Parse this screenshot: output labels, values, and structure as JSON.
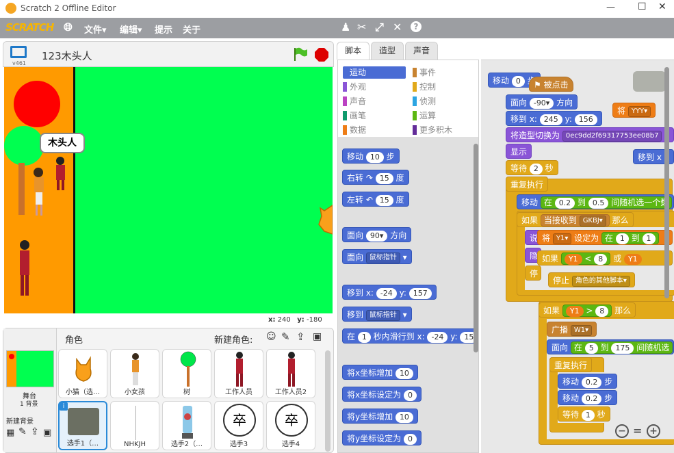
{
  "window": {
    "title": "Scratch 2 Offline Editor",
    "min": "—",
    "max": "☐",
    "close": "✕"
  },
  "menu": {
    "logo": "SCRATCH",
    "file": "文件▾",
    "edit": "编辑▾",
    "tips": "提示",
    "about": "关于"
  },
  "stage": {
    "version": "v461",
    "project_name": "123木头人",
    "speech": "木头人",
    "coord_x_label": "x:",
    "coord_x": "240",
    "coord_y_label": "y:",
    "coord_y": "-180"
  },
  "sprites": {
    "header": "角色",
    "new_sprite": "新建角色:",
    "stage_label": "舞台",
    "stage_sub": "1 背景",
    "new_backdrop": "新建背景",
    "items": [
      "小猫（选…",
      "小女孩",
      "树",
      "工作人员",
      "工作人员2",
      "选手1（…",
      "NHKJH",
      "选手2（…",
      "选手3",
      "选手4"
    ]
  },
  "tabs": [
    "脚本",
    "造型",
    "声音"
  ],
  "categories": {
    "left": [
      "运动",
      "外观",
      "声音",
      "画笔",
      "数据"
    ],
    "right": [
      "事件",
      "控制",
      "侦测",
      "运算",
      "更多积木"
    ]
  },
  "palette": {
    "move": "移动",
    "move_n": "10",
    "move_unit": "步",
    "turn_r": "右转",
    "turn_r_n": "15",
    "deg": "度",
    "turn_l": "左转",
    "turn_l_n": "15",
    "face": "面向",
    "face_n": "90▾",
    "face_unit": "方向",
    "face2": "面向",
    "face2_dd": "鼠标指针",
    "goto": "移到 x:",
    "goto_x": "-24",
    "goto_y_label": "y:",
    "goto_y": "157",
    "goto2": "移到",
    "goto2_dd": "鼠标指针",
    "glide_in": "在",
    "glide_n": "1",
    "glide_mid": "秒内滑行到 x:",
    "glide_x": "-24",
    "glide_y": "y:",
    "glide_y_n": "15",
    "chx": "将x坐标增加",
    "chx_n": "10",
    "setx": "将x坐标设定为",
    "setx_n": "0",
    "chy": "将y坐标增加",
    "chy_n": "10",
    "sety": "将y坐标设定为",
    "sety_n": "0"
  },
  "script": {
    "s1": "移动",
    "s1n": "0",
    "s1u": "步",
    "clicked": "被点击",
    "face": "面向",
    "face_n": "-90▾",
    "face_u": "方向",
    "goto": "移到 x:",
    "gx": "245",
    "gy_l": "y:",
    "gy": "156",
    "costume": "将造型切换为",
    "costume_v": "0ec9dd2f69317753ee08b7",
    "show": "显示",
    "wait": "等待",
    "wait_n": "2",
    "wait_u": "秒",
    "forever": "重复执行",
    "move_in": "移动",
    "in": "在",
    "r1": "0.2",
    "to": "到",
    "r2": "0.5",
    "rand": "间随机选一个数",
    "if1": "如果",
    "recv": "当接收到",
    "msg": "GKBJ▾",
    "then": "那么",
    "set": "将",
    "var": "Y1▾",
    "set_to": "设定为",
    "set_in": "在",
    "set_a": "1",
    "set_b": "1",
    "say": "说",
    "hide": "隐",
    "stop_s": "停",
    "if2": "如果",
    "y1": "Y1",
    "lt": "<",
    "lt_n": "8",
    "or": "或",
    "y1b": "Y1",
    "stop": "停止",
    "stop_dd": "角色的其他脚本▾",
    "if3": "如果",
    "gt": ">",
    "gt_n": "8",
    "then3": "那么",
    "bcast": "广播",
    "bcast_v": "W1▾",
    "face2": "面向",
    "f_in": "在",
    "f_a": "5",
    "f_to": "到",
    "f_b": "175",
    "f_rand": "间随机选",
    "forever2": "重复执行",
    "m1": "移动",
    "m1n": "0.2",
    "m1u": "步",
    "m2": "移动",
    "m2n": "0.2",
    "m2u": "步",
    "w2": "等待",
    "w2n": "1",
    "w2u": "秒",
    "setYYY": "将",
    "yyy": "YYY▾",
    "goto_x": "移到 x",
    "zoom_out": "−",
    "zoom_reset": "=",
    "zoom_in": "+"
  },
  "colors": {
    "motion": "#4a6cd4",
    "looks": "#8a55d7",
    "sound": "#bb42c3",
    "pen": "#0e9a6c",
    "data": "#ee7d16",
    "events": "#c88330",
    "control": "#e1a91a",
    "sensing": "#2ca5e2",
    "operators": "#5cb712",
    "more": "#632d99"
  }
}
